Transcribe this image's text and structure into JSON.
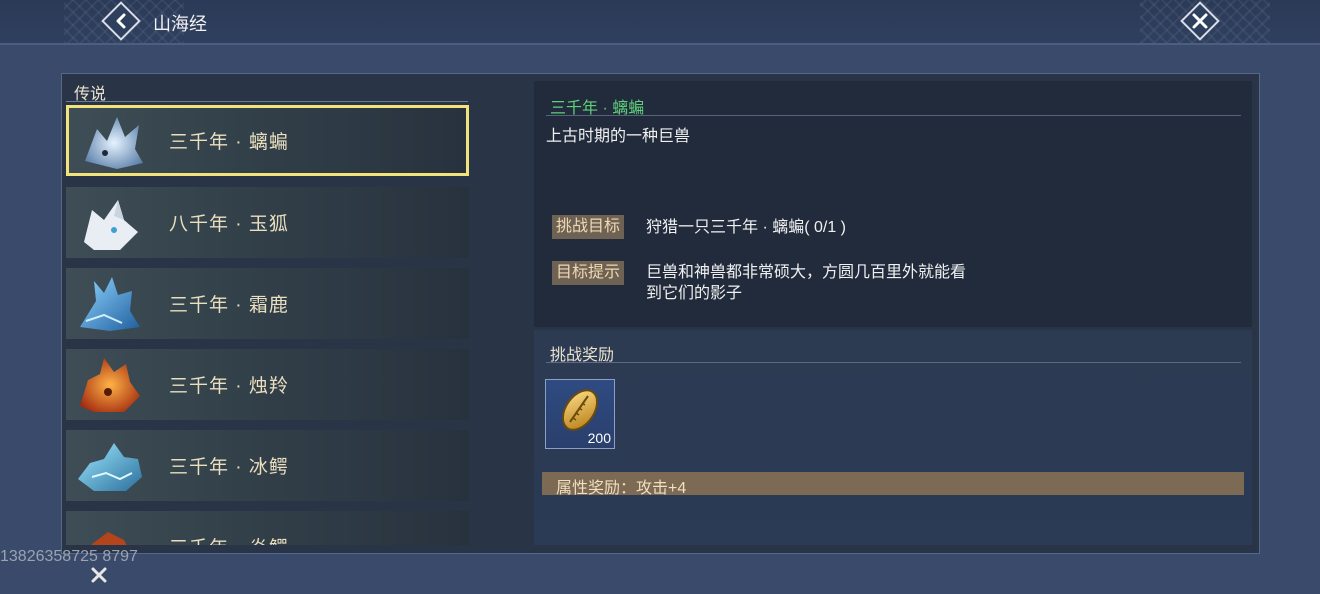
{
  "header": {
    "title": "山海经",
    "back_icon": "back-arrow-icon",
    "close_icon": "close-icon"
  },
  "sidebar": {
    "section_title": "传说",
    "items": [
      {
        "label": "三千年 · 螭蝙",
        "selected": true,
        "icon": "creature-ice-beast"
      },
      {
        "label": "八千年 · 玉狐",
        "selected": false,
        "icon": "creature-white-fox"
      },
      {
        "label": "三千年 · 霜鹿",
        "selected": false,
        "icon": "creature-frost-deer"
      },
      {
        "label": "三千年 · 烛羚",
        "selected": false,
        "icon": "creature-fire-antelope"
      },
      {
        "label": "三千年 · 冰鳄",
        "selected": false,
        "icon": "creature-ice-crocodile"
      },
      {
        "label": "三千年 · 炎鳄",
        "selected": false,
        "icon": "creature-fire-beast"
      }
    ]
  },
  "detail": {
    "title": "三千年 · 螭蝙",
    "description": "上古时期的一种巨兽",
    "challenge_label": "挑战目标",
    "challenge_text": "狩猎一只三千年 · 螭蝙( 0/1 )",
    "hint_label": "目标提示",
    "hint_line1": "巨兽和神兽都非常硕大，方圆几百里外就能看",
    "hint_line2": "到它们的影子"
  },
  "reward": {
    "title": "挑战奖励",
    "item_icon": "golden-shell-icon",
    "item_count": "200",
    "attr_text": "属性奖励：攻击+4"
  },
  "watermark": "13826358725 8797",
  "colors": {
    "selected_border": "#f2e47a",
    "detail_title": "#5fd07a",
    "tag_bg": "#6e6255",
    "attr_bar": "#7c6a55"
  }
}
